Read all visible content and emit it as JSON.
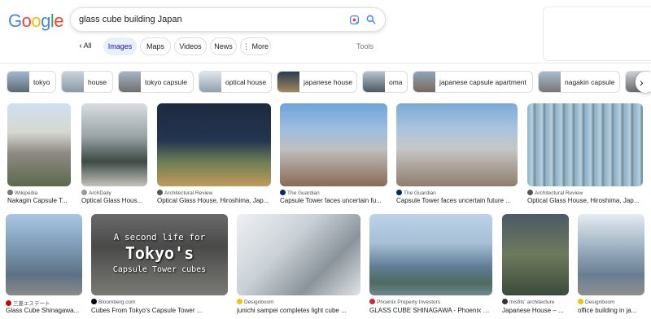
{
  "search": {
    "query": "glass cube building Japan"
  },
  "logo": {
    "text": "Google"
  },
  "tabs": {
    "all": "All",
    "images": "Images",
    "maps": "Maps",
    "videos": "Videos",
    "news": "News",
    "more": "More",
    "tools": "Tools"
  },
  "chips": [
    {
      "label": "tokyo"
    },
    {
      "label": "house"
    },
    {
      "label": "tokyo capsule"
    },
    {
      "label": "optical house"
    },
    {
      "label": "japanese house"
    },
    {
      "label": "oma"
    },
    {
      "label": "japanese capsule apartment"
    },
    {
      "label": "nagakin capsule"
    }
  ],
  "results_row1": [
    {
      "source": "Wikipedia",
      "title": "Nakagin Capsule T..."
    },
    {
      "source": "ArchDaily",
      "title": "Optical Glass Hous..."
    },
    {
      "source": "Architectural Review",
      "title": "Optical Glass House, Hiroshima, Jap..."
    },
    {
      "source": "The Guardian",
      "title": "Capsule Tower faces uncertain fu..."
    },
    {
      "source": "The Guardian",
      "title": "Capsule Tower faces uncertain future ..."
    },
    {
      "source": "Architectural Review",
      "title": "Optical Glass House, Hiroshima, Jap..."
    }
  ],
  "results_row2": [
    {
      "source": "三菱エステート",
      "title": "Glass Cube Shinagawa..."
    },
    {
      "source": "Bloomberg.com",
      "title": "Cubes From Tokyo's Capsule Tower ..."
    },
    {
      "source": "Designboom",
      "title": "junichi sampei completes light cube ..."
    },
    {
      "source": "Phoenix Property Investors",
      "title": "GLASS CUBE SHINAGAWA - Phoenix Pr..."
    },
    {
      "source": "misfits' architecture",
      "title": "Japanese House – ..."
    },
    {
      "source": "Designboom",
      "title": "office building in ja..."
    }
  ],
  "overlay": {
    "line1": "A second life for",
    "line2": "Tokyo's",
    "line3": "Capsule Tower cubes"
  },
  "colors": {
    "blue": "#4285f4",
    "red": "#ea4335",
    "yellow": "#fbbc05",
    "green": "#34a853",
    "active_tab_bg": "#e8f0fe"
  }
}
